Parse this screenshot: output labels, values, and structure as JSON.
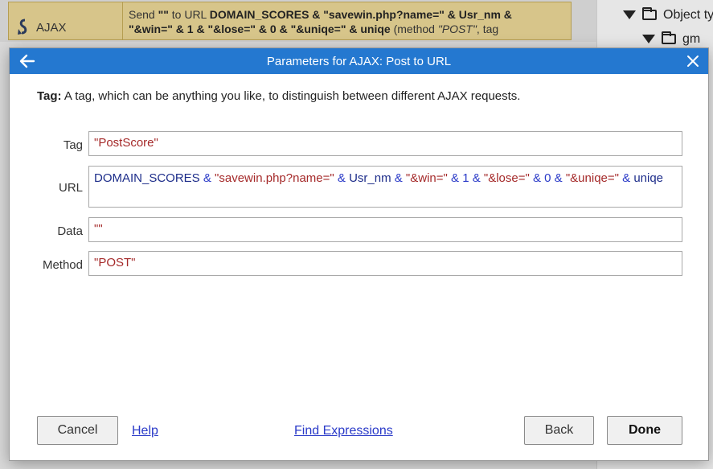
{
  "background": {
    "action_name": "AJAX",
    "action_icon": "ajax-icon",
    "param_line1_pre": "Send ",
    "param_line1_q": "\"\"",
    "param_line1_mid": " to URL ",
    "param_line1_bold": "DOMAIN_SCORES & \"savewin.php?name=\" & Usr_nm &",
    "param_line2_bold": "\"&win=\" & 1 & \"&lose=\" & 0 & \"&uniqe=\" & uniqe",
    "param_line2_rest": " (method ",
    "param_line2_method": "\"POST\"",
    "param_line2_tail": ", tag",
    "tree": [
      {
        "label": "Object ty",
        "icon": "folder-icon"
      },
      {
        "label": "gm",
        "icon": "folder-icon"
      }
    ]
  },
  "dialog": {
    "title": "Parameters for AJAX: Post to URL",
    "help_label": "Tag:",
    "help_text": " A tag, which can be anything you like, to distinguish between different AJAX requests.",
    "fields": {
      "tag": {
        "label": "Tag",
        "value": "\"PostScore\""
      },
      "url": {
        "label": "URL",
        "tokens": [
          {
            "t": "DOMAIN_SCORES",
            "k": "id"
          },
          {
            "t": " & ",
            "k": "op"
          },
          {
            "t": "\"savewin.php?name=\"",
            "k": "str"
          },
          {
            "t": " & ",
            "k": "op"
          },
          {
            "t": "Usr_nm",
            "k": "id"
          },
          {
            "t": " & ",
            "k": "op"
          },
          {
            "t": "\"&win=\"",
            "k": "str"
          },
          {
            "t": " & ",
            "k": "op"
          },
          {
            "t": "1",
            "k": "num"
          },
          {
            "t": " & ",
            "k": "op"
          },
          {
            "t": "\"&lose=\"",
            "k": "str"
          },
          {
            "t": " & ",
            "k": "op"
          },
          {
            "t": "0",
            "k": "num"
          },
          {
            "t": " & ",
            "k": "op"
          },
          {
            "t": "\"&uniqe=\"",
            "k": "str"
          },
          {
            "t": " & ",
            "k": "op"
          },
          {
            "t": "uniqe",
            "k": "id"
          }
        ]
      },
      "data": {
        "label": "Data",
        "value": "\"\""
      },
      "method": {
        "label": "Method",
        "value": "\"POST\""
      }
    },
    "buttons": {
      "cancel": "Cancel",
      "help": "Help",
      "find_expressions": "Find Expressions",
      "back": "Back",
      "done": "Done"
    },
    "colors": {
      "titlebar": "#2478d0",
      "string": "#a52a2a",
      "operator": "#2a3ac8",
      "link": "#2a3ac8"
    }
  }
}
